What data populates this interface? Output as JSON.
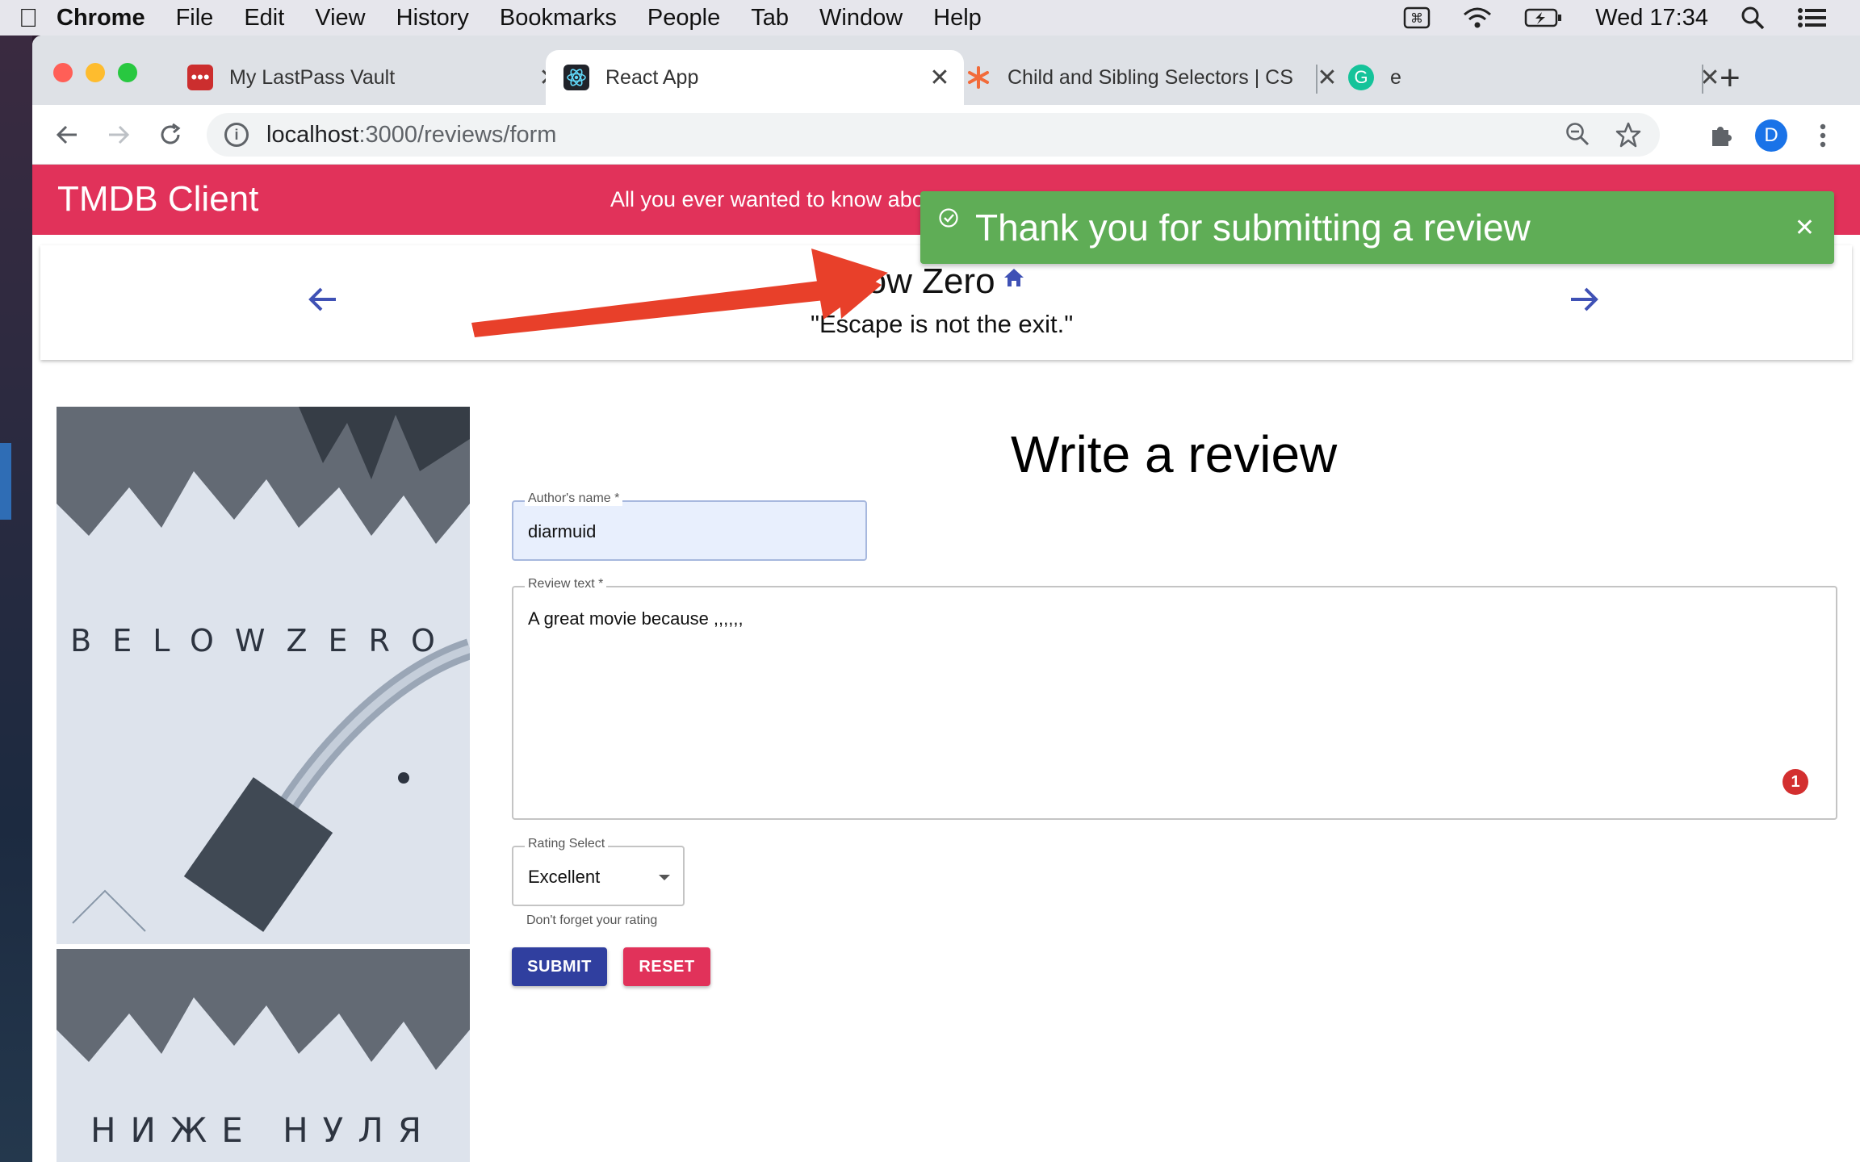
{
  "menubar": {
    "app": "Chrome",
    "items": [
      "File",
      "Edit",
      "View",
      "History",
      "Bookmarks",
      "People",
      "Tab",
      "Window",
      "Help"
    ],
    "clock": "Wed 17:34"
  },
  "tabs": [
    {
      "title": "My LastPass Vault",
      "icon": "lastpass-icon"
    },
    {
      "title": "React App",
      "icon": "react-icon"
    },
    {
      "title": "Child and Sibling Selectors | CS",
      "icon": "css-tricks-icon"
    },
    {
      "title": "e",
      "icon": "grammarly-icon"
    }
  ],
  "address": {
    "host": "localhost",
    "path": ":3000/reviews/form"
  },
  "profile_initial": "D",
  "app": {
    "brand": "TMDB Client",
    "tagline": "All you ever wanted to know abo"
  },
  "movie": {
    "title": "Below Zero",
    "tagline": "\"Escape is not the exit.\"",
    "poster_titles": [
      "BELOWZERO",
      "НИЖЕ НУЛЯ"
    ]
  },
  "form": {
    "heading": "Write a review",
    "author_label": "Author's name *",
    "author_value": "diarmuid",
    "review_label": "Review text *",
    "review_value": "A great movie because ,,,,,,",
    "error_count": "1",
    "rating_label": "Rating Select",
    "rating_value": "Excellent",
    "rating_helper": "Don't forget your rating",
    "submit_label": "SUBMIT",
    "reset_label": "RESET"
  },
  "toast": {
    "message": "Thank you for submitting a review"
  },
  "colors": {
    "appbar": "#e1325a",
    "toast": "#5fad56",
    "primary": "#303f9f",
    "annotation_arrow": "#e8402a"
  }
}
